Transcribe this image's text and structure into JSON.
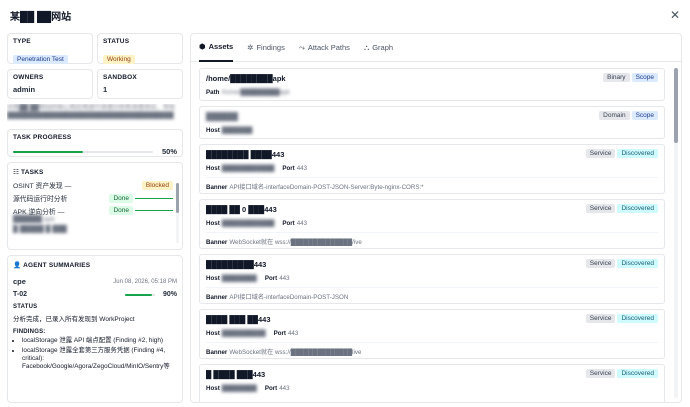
{
  "window": {
    "title": "某██ ██网站"
  },
  "meta": {
    "type_label": "TYPE",
    "type_value": "Penetration Test",
    "status_label": "STATUS",
    "status_value": "Working",
    "owners_label": "OWNERS",
    "owners_value": "admin",
    "sandbox_label": "SANDBOX",
    "sandbox_value": "1"
  },
  "description": "对某██ ██网站的核心和应用进行渗透分析和渗透测试，寻找██████████████████████████████████████",
  "progress": {
    "label": "TASK PROGRESS",
    "value_text": "50%",
    "fraction": 0.5
  },
  "tasks": {
    "label": "TASKS",
    "items": [
      {
        "name": "OSINT 资产发现 —",
        "status": "Blocked",
        "progress": 0.0
      },
      {
        "name": "源代码运行时分析",
        "status": "Done",
        "progress": 1.0
      },
      {
        "name": "APK 逆向分析 —",
        "sub": "██████.apk",
        "status": "Done",
        "progress": 1.0
      },
      {
        "name": "█ █████ █ ███",
        "status": "",
        "progress": 0.0
      }
    ]
  },
  "agents": {
    "label": "AGENT SUMMARIES",
    "name": "cpe",
    "timestamp": "Jun 08, 2026, 05:18 PM",
    "agent_id": "T-02",
    "agent_progress_text": "90%",
    "agent_progress": 0.9,
    "status_label": "STATUS",
    "status_text": "分析完成，已录入所有发现到 WorkProject",
    "findings_label": "FINDINGS:",
    "findings": [
      "localStorage 泄露 API 端点配置 (Finding #2, high)",
      "localStorage 泄露全套第三方服务凭据 (Finding #4, critical): Facebook/Google/Agora/ZegoCloud/MinIO/Sentry等"
    ]
  },
  "tabs": [
    {
      "label": "Assets",
      "icon": "cube-icon",
      "active": true
    },
    {
      "label": "Findings",
      "icon": "bug-icon",
      "active": false
    },
    {
      "label": "Attack Paths",
      "icon": "path-icon",
      "active": false
    },
    {
      "label": "Graph",
      "icon": "graph-icon",
      "active": false
    }
  ],
  "assets": [
    {
      "title": "/home/████████apk",
      "row1_label": "Path",
      "row1_value": "/home/█████████apk",
      "badges": [
        "Binary",
        "Scope"
      ]
    },
    {
      "title": "██████",
      "row1_label": "Host",
      "row1_value": "███████",
      "badges": [
        "Domain",
        "Scope"
      ]
    },
    {
      "title": "████████ ████443",
      "row1_label": "Host",
      "row1_value": "████████████",
      "port_label": "Port",
      "port_value": "443",
      "banner_label": "Banner",
      "banner_value": "API接口域名-interfaceDomain-POST-JSON-Server:Byte-nginx-CORS:*",
      "badges": [
        "Service",
        "Discovered"
      ]
    },
    {
      "title": "████ ██ 0 ███443",
      "row1_label": "Host",
      "row1_value": "████████████",
      "port_label": "Port",
      "port_value": "443",
      "banner_label": "Banner",
      "banner_value": "WebSocket就在 wss://██████████████/ive",
      "badges": [
        "Service",
        "Discovered"
      ]
    },
    {
      "title": "█████████443",
      "row1_label": "Host",
      "row1_value": "████████",
      "port_label": "Port",
      "port_value": "443",
      "banner_label": "Banner",
      "banner_value": "API接口域名-interfaceDomain-POST-JSON",
      "badges": [
        "Service",
        "Discovered"
      ]
    },
    {
      "title": "████ ███ ██443",
      "row1_label": "Host",
      "row1_value": "██████████",
      "port_label": "Port",
      "port_value": "443",
      "banner_label": "Banner",
      "banner_value": "WebSocket就在 wss://██████████████live",
      "badges": [
        "Service",
        "Discovered"
      ]
    },
    {
      "title": "█ ████ ███443",
      "row1_label": "Host",
      "row1_value": "████████",
      "port_label": "Port",
      "port_value": "443",
      "badges": [
        "Service",
        "Discovered"
      ]
    }
  ],
  "colors": {
    "accent_green": "#16a34a",
    "badge_blue": "#dbeafe",
    "badge_yellow": "#fef3c7"
  }
}
